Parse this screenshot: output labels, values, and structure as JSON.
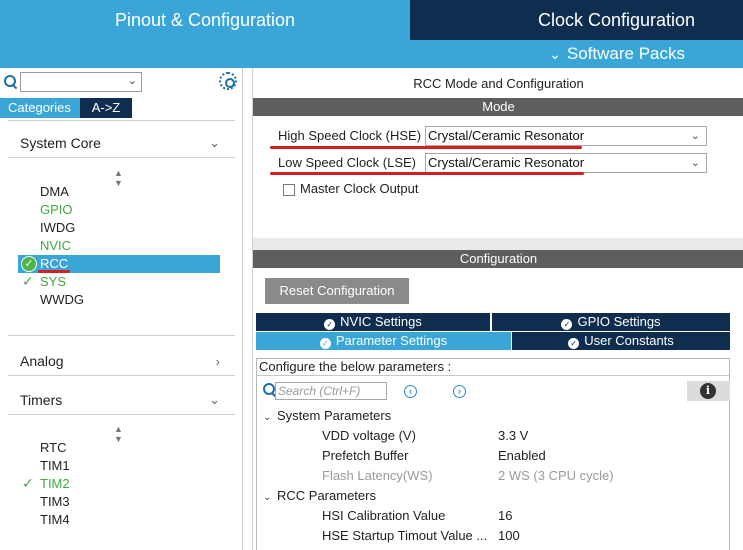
{
  "top_tabs": {
    "pinout": "Pinout & Configuration",
    "clock": "Clock Configuration",
    "software_packs": "Software Packs"
  },
  "left": {
    "search_value": "",
    "tabs": [
      "Categories",
      "A->Z"
    ],
    "sections": {
      "system_core": "System Core",
      "analog": "Analog",
      "timers": "Timers"
    },
    "system_core_items": [
      "DMA",
      "GPIO",
      "IWDG",
      "NVIC",
      "RCC",
      "SYS",
      "WWDG"
    ],
    "timer_items": [
      "RTC",
      "TIM1",
      "TIM2",
      "TIM3",
      "TIM4"
    ]
  },
  "right": {
    "title": "RCC Mode and Configuration",
    "mode_header": "Mode",
    "hse_label": "High Speed Clock (HSE)",
    "hse_value": "Crystal/Ceramic Resonator",
    "lse_label": "Low Speed Clock (LSE)",
    "lse_value": "Crystal/Ceramic Resonator",
    "mco_label": "Master Clock Output",
    "config_header": "Configuration",
    "reset_button": "Reset Configuration",
    "settings_tabs": {
      "nvic": "NVIC Settings",
      "gpio": "GPIO Settings",
      "parameter": "Parameter Settings",
      "user_constants": "User Constants"
    },
    "param_caption": "Configure the below parameters :",
    "search_placeholder": "Search (Ctrl+F)",
    "groups": {
      "system": "System Parameters",
      "rcc": "RCC Parameters"
    },
    "system_params": [
      {
        "name": "VDD voltage (V)",
        "value": "3.3 V"
      },
      {
        "name": "Prefetch Buffer",
        "value": "Enabled"
      },
      {
        "name": "Flash Latency(WS)",
        "value": "2 WS (3 CPU cycle)"
      }
    ],
    "rcc_params": [
      {
        "name": "HSI Calibration Value",
        "value": "16"
      },
      {
        "name": "HSE Startup Timout Value ...",
        "value": "100"
      }
    ]
  },
  "colors": {
    "accent_light": "#3aa6d8",
    "accent_dark": "#0e2d4f",
    "enabled_green": "#3fa93f",
    "annotation_red": "#d51e1e"
  }
}
